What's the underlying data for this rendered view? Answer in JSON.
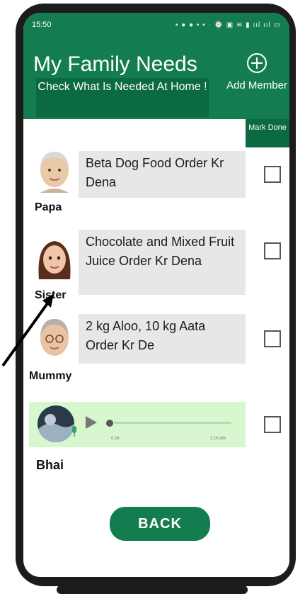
{
  "status_bar": {
    "time": "15:50",
    "indicators": "▪ ● ● ▪ ▪ ·    ⌚ ▣ ≋ ▮ ııl ııl ▭"
  },
  "header": {
    "title": "My Family Needs",
    "subtitle": "Check What Is Needed At Home !",
    "add_member_label": "Add Member",
    "add_icon": "plus-circle-icon"
  },
  "mark_done_label": "Mark Done",
  "members": [
    {
      "name": "Papa",
      "need": "Beta Dog Food Order Kr Dena",
      "done": false
    },
    {
      "name": "Sister",
      "need": "Chocolate and Mixed Fruit Juice Order Kr Dena",
      "done": false
    },
    {
      "name": "Mummy",
      "need": "2 kg Aloo, 10 kg Aata Order Kr De",
      "done": false
    },
    {
      "name": "Bhai",
      "need_type": "voice note",
      "voice": {
        "elapsed": "0:04",
        "time": "2:16 AM"
      },
      "done": false
    }
  ],
  "back_label": "BACK",
  "colors": {
    "primary_green": "#137d50",
    "dark_green": "#0c6a40",
    "need_bg": "#e7e7e7",
    "voice_bg": "#d7f7cf"
  }
}
